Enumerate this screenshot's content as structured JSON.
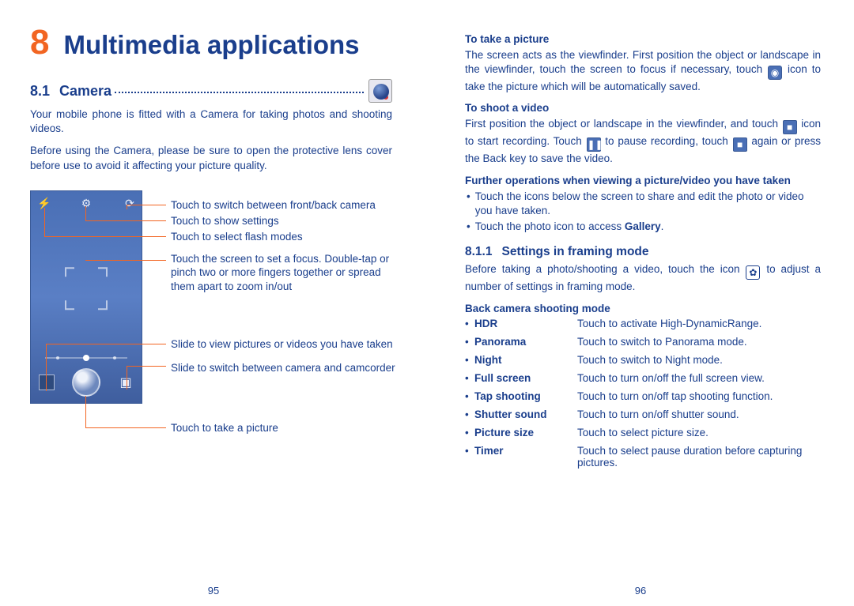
{
  "chapter": {
    "number": "8",
    "title": "Multimedia applications"
  },
  "page_left_num": "95",
  "page_right_num": "96",
  "sec81": {
    "num": "8.1",
    "title": "Camera"
  },
  "intro_p1": "Your mobile phone is fitted with a Camera for taking photos and shooting videos.",
  "intro_p2": "Before using the Camera, please be sure to open the protective lens cover before use to avoid it affecting your picture quality.",
  "callouts": {
    "c1": "Touch to switch between front/back camera",
    "c2": "Touch to show settings",
    "c3": "Touch to select flash modes",
    "c4": "Touch the screen to set a focus. Double-tap or pinch two or more fingers together or spread them apart to zoom in/out",
    "c5": "Slide to view pictures or videos you have taken",
    "c6": "Slide to switch between camera and camcorder",
    "c7": "Touch to take a picture"
  },
  "right": {
    "h_take_pic": "To take a picture",
    "p_take_pic_a": "The screen acts as the viewfinder. First position the object or landscape in the viewfinder, touch the screen to focus if necessary, touch ",
    "p_take_pic_b": " icon to take the picture which will be automatically saved.",
    "h_shoot_vid": "To shoot a video",
    "p_shoot_a": "First position the object or landscape in the viewfinder, and touch ",
    "p_shoot_b": " icon to start recording. Touch ",
    "p_shoot_c": " to pause recording, touch ",
    "p_shoot_d": " again or press the Back key to save the video.",
    "h_further": "Further operations when viewing a picture/video you have taken",
    "bul1": "Touch the icons below the screen to share and edit the photo or video you have taken.",
    "bul2_a": "Touch the photo icon to access ",
    "bul2_b": "Gallery",
    "bul2_c": ".",
    "sec811_num": "8.1.1",
    "sec811_title": "Settings in framing mode",
    "p811_a": "Before taking a photo/shooting a video, touch the icon ",
    "p811_b": " to adjust a number of settings in framing mode.",
    "h_back_mode": "Back camera shooting mode",
    "modes": {
      "hdr": {
        "label": "HDR",
        "desc": "Touch to activate High-DynamicRange."
      },
      "panorama": {
        "label": "Panorama",
        "desc": "Touch to switch to Panorama mode."
      },
      "night": {
        "label": "Night",
        "desc": "Touch to switch to Night mode."
      },
      "full_screen": {
        "label": "Full screen",
        "desc": "Touch to turn on/off the full screen view."
      },
      "tap_shooting": {
        "label": "Tap shooting",
        "desc": "Touch to turn on/off tap shooting function."
      },
      "shutter_sound": {
        "label": "Shutter sound",
        "desc": "Touch to turn on/off shutter sound."
      },
      "picture_size": {
        "label": "Picture size",
        "desc": "Touch to select picture size."
      },
      "timer": {
        "label": "Timer",
        "desc": "Touch to select pause duration before capturing pictures."
      }
    }
  }
}
